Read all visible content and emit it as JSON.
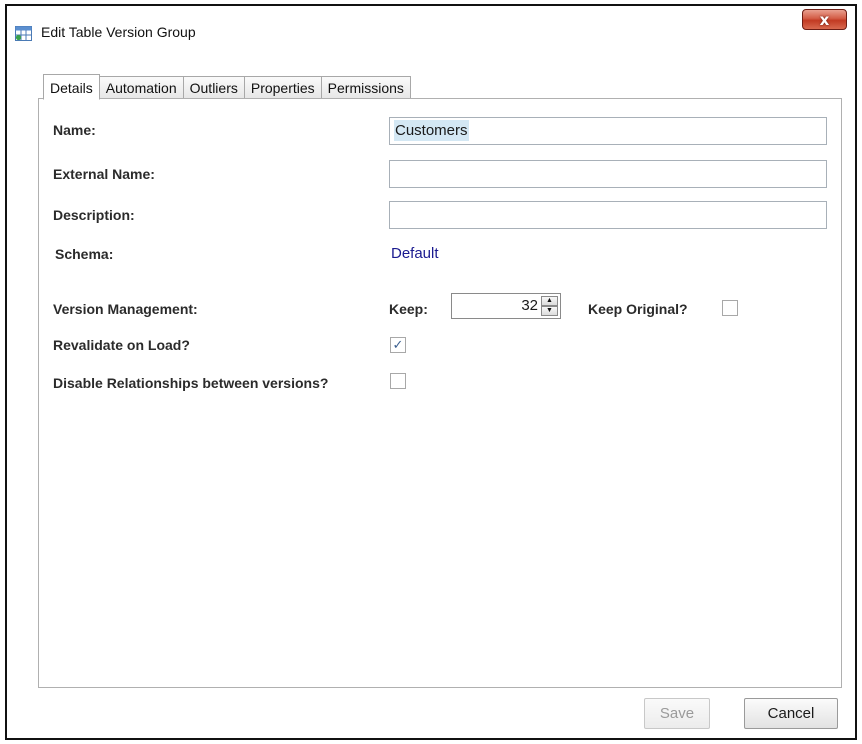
{
  "window": {
    "title": "Edit Table Version Group",
    "close_label": "x"
  },
  "tabs": [
    {
      "label": "Details",
      "active": true
    },
    {
      "label": "Automation",
      "active": false
    },
    {
      "label": "Outliers",
      "active": false
    },
    {
      "label": "Properties",
      "active": false
    },
    {
      "label": "Permissions",
      "active": false
    }
  ],
  "form": {
    "name_label": "Name:",
    "name_value": "Customers",
    "external_name_label": "External Name:",
    "external_name_value": "",
    "description_label": "Description:",
    "description_value": "",
    "schema_label": "Schema:",
    "schema_value": "Default",
    "version_management_label": "Version Management:",
    "keep_label": "Keep:",
    "keep_value": "32",
    "keep_original_label": "Keep Original?",
    "keep_original_checked": false,
    "revalidate_label": "Revalidate on Load?",
    "revalidate_checked": true,
    "disable_relationships_label": "Disable Relationships between versions?",
    "disable_relationships_checked": false
  },
  "buttons": {
    "save_label": "Save",
    "save_enabled": false,
    "cancel_label": "Cancel"
  },
  "icons": {
    "checkmark": "✓",
    "spin_up": "▲",
    "spin_down": "▼"
  }
}
